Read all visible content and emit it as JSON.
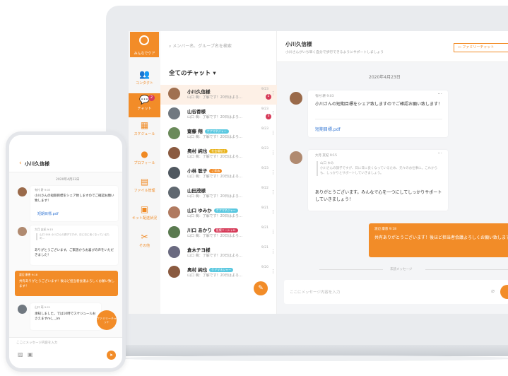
{
  "rail": {
    "logo_label": "みんなでケア",
    "items": [
      {
        "label": "コンタクト"
      },
      {
        "label": "チャット",
        "badge": "2"
      },
      {
        "label": "スケジュール"
      },
      {
        "label": "プロフィール"
      },
      {
        "label": "ファイル管理"
      },
      {
        "label": "キット配送状況"
      },
      {
        "label": "その他"
      }
    ]
  },
  "list": {
    "search_placeholder": "メンバー名、グループ名を検索",
    "title": "全てのチャット ▾",
    "chats": [
      {
        "name": "小川久信様",
        "msg": "山口 萌：了解です！20日はよろ…",
        "date": "9/23",
        "badge": "2",
        "tag": "",
        "tag_color": ""
      },
      {
        "name": "山谷香様",
        "msg": "山口 萌：了解です！20日はよろ…",
        "date": "9/23",
        "badge": "3",
        "tag": "",
        "tag_color": ""
      },
      {
        "name": "齋藤 翔",
        "msg": "山口 萌：了解です！20日はよろ…",
        "date": "9/23",
        "badge": "",
        "tag": "ケアマネジャー",
        "tag_color": "#5ac8e0"
      },
      {
        "name": "奥村 純也",
        "msg": "山口 萌：了解です！20日はよろ…",
        "date": "9/23",
        "badge": "",
        "tag": "社会福祉士",
        "tag_color": "#e8b21a"
      },
      {
        "name": "小林 聡子",
        "msg": "山口 萌：了解です！20日はよろ…",
        "date": "9/23",
        "badge": "",
        "tag": "ご家族",
        "tag_color": "#f28c28"
      },
      {
        "name": "山田茂様",
        "msg": "山口 萌：了解です！20日はよろ…",
        "date": "9/22",
        "badge": "",
        "tag": "",
        "tag_color": ""
      },
      {
        "name": "山口 ゆみか",
        "msg": "山口 萌：了解です！20日はよろ…",
        "date": "9/21",
        "badge": "",
        "tag": "ケアマネジャー",
        "tag_color": "#5ac8e0"
      },
      {
        "name": "川口 あかり",
        "msg": "山口 萌：了解です！20日はよろ…",
        "date": "9/21",
        "badge": "",
        "tag": "医療ソーシャル",
        "tag_color": "#d63a58"
      },
      {
        "name": "倉木チヨ様",
        "msg": "山口 萌：了解です！20日はよろ…",
        "date": "9/21",
        "badge": "",
        "tag": "",
        "tag_color": ""
      },
      {
        "name": "奥村 純也",
        "msg": "山口 萌：了解です！20日はよろ…",
        "date": "9/20",
        "badge": "",
        "tag": "ケアマネジャー",
        "tag_color": "#5ac8e0"
      }
    ]
  },
  "chat": {
    "title": "小川久信様",
    "subtitle": "小川さんがいち早く自分で歩行できるようにサポートしましょう",
    "family_button": "ファミリーチャット",
    "date": "2020年4月23日",
    "msg1": {
      "meta": "有村 耕 9:03",
      "text": "小川さんの短期目標をシェア致しますのでご確認お願い致します！",
      "file": "短期目標.pdf"
    },
    "msg2": {
      "meta": "大月 友紀 9:15",
      "quote_name": "山口 ゆみ",
      "quote_text": "小川さんの調子ですが、日に日に良くなっているため、元々のお仕事に。これからも、しっかりとサポートしていきましょう。",
      "text": "ありがとうございます。みんなで心を一つにしてしっかりサポートしていきましょう！"
    },
    "msg3": {
      "meta": "渡辺 康恵 9:18",
      "text": "共有ありがとうございます！後ほど担当者会議よろしくお願い致します！"
    },
    "unread": "未読メッセージ",
    "input_placeholder": "ここにメッセージ内容を入力"
  },
  "phone": {
    "title": "小川久信様",
    "date": "2020年4月23日",
    "msg1": {
      "meta": "有村 耕 9:03",
      "text": "小川さんの短期目標をシェア致しますのでご確認お願い致します！",
      "file": "短期目標.pdf"
    },
    "msg2": {
      "meta": "大月 友紀 9:15",
      "quote": "山口 ゆみ 小川さんの調子ですが、日に日に良くなっているため…",
      "text": "ありがとうございます。ご家族からお喜びの声をいただきました！"
    },
    "msg3": {
      "meta": "渡辺 康恵 9:18",
      "text": "共有ありがとうございます！後ほど担当者会議よろしくお願い致します！"
    },
    "msg4": {
      "meta": "山口 萌 9:21",
      "text": "承知しました。では10時でスケジュールおさえますm(_ _)m"
    },
    "family_fab": "ファミリーチャット",
    "input_placeholder": "ここにメッセージ内容を入力"
  }
}
